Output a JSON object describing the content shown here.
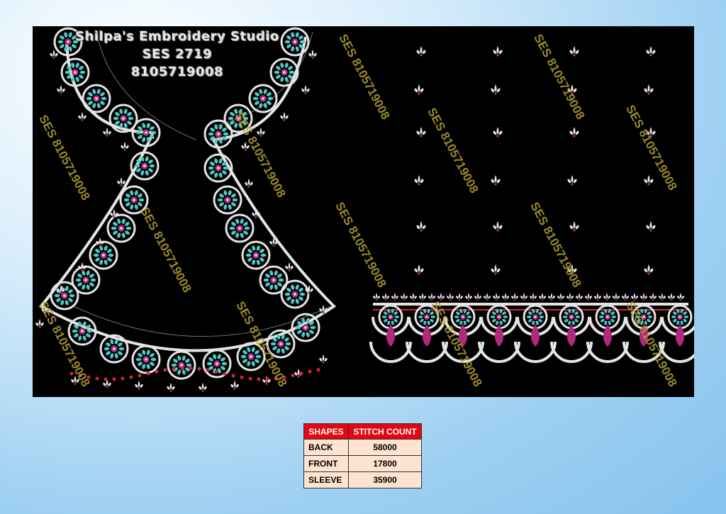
{
  "studio": {
    "name": "Shilpa's Embroidery Studio",
    "code": "SES  2719",
    "phone": "8105719008"
  },
  "watermark_text": "SES 8105719008",
  "table": {
    "headers": [
      "SHAPES",
      "STITCH COUNT"
    ],
    "rows": [
      {
        "shape": "BACK",
        "count": "58000"
      },
      {
        "shape": "FRONT",
        "count": "17800"
      },
      {
        "shape": "SLEEVE",
        "count": "35900"
      }
    ]
  },
  "colors": {
    "panel": "#000000",
    "thread_white": "#e4e4e4",
    "thread_turquoise": "#4ec9c4",
    "thread_magenta": "#b1287f",
    "thread_red": "#d8233a",
    "header_red": "#e30613",
    "cell_peach": "#fde3d0"
  }
}
